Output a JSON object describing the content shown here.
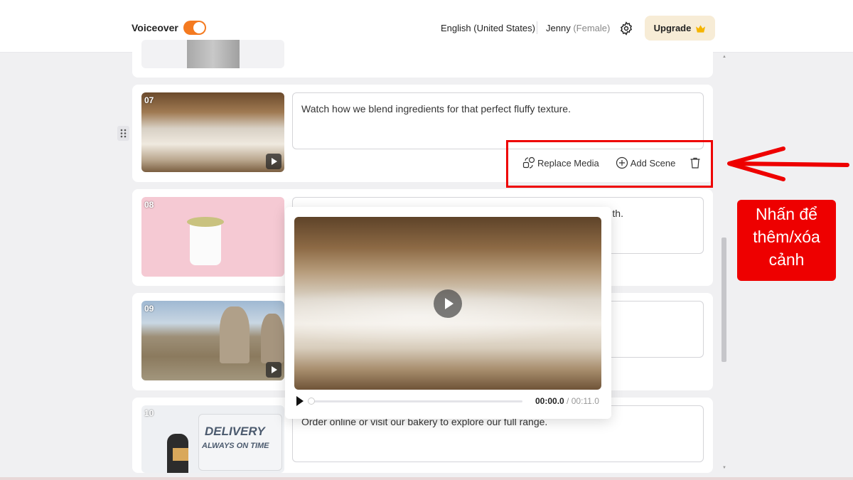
{
  "header": {
    "voiceover_label": "Voiceover",
    "voiceover_enabled": true,
    "language": "English (United States)",
    "voice_name": "Jenny",
    "voice_gender": "(Female)",
    "upgrade_label": "Upgrade"
  },
  "scenes": [
    {
      "number": "07",
      "script": "Watch how we blend ingredients for that perfect fluffy texture."
    },
    {
      "number": "08",
      "script": "th."
    },
    {
      "number": "09",
      "script": ""
    },
    {
      "number": "10",
      "script": "Order online or visit our bakery to explore our full range."
    }
  ],
  "scene_actions": {
    "replace_media": "Replace Media",
    "add_scene": "Add Scene"
  },
  "player": {
    "current_time": "00:00.0",
    "duration": "/ 00:11.0",
    "progress": 0
  },
  "annotation": {
    "line1": "Nhấn để",
    "line2": "thêm/xóa",
    "line3": "cảnh"
  },
  "thumbnail_text": {
    "delivery": "DELIVERY",
    "tagline": "ALWAYS ON TIME"
  },
  "colors": {
    "accent": "#f47a20",
    "annotation_red": "#e00000",
    "upgrade_bg": "#f7ecd6"
  }
}
